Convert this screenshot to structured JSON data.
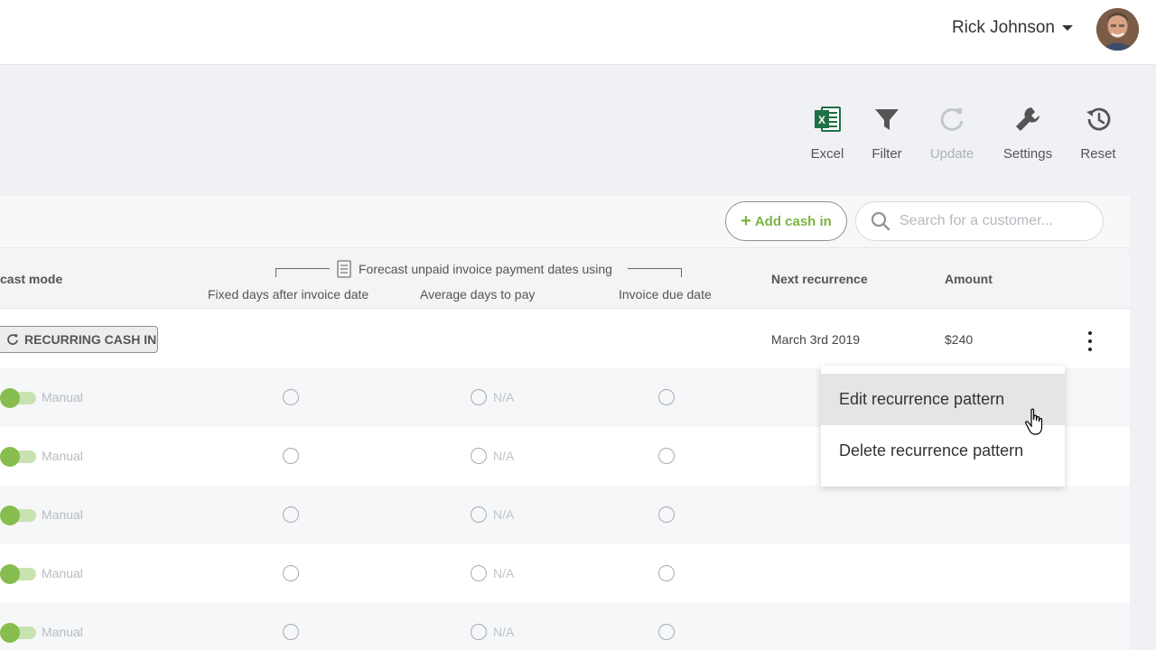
{
  "header": {
    "user_name": "Rick Johnson"
  },
  "toolbar": {
    "items": [
      {
        "label": "Excel",
        "icon": "excel-icon",
        "color": "#1e7145",
        "enabled": true
      },
      {
        "label": "Filter",
        "icon": "filter-icon",
        "enabled": true
      },
      {
        "label": "Update",
        "icon": "refresh-icon",
        "enabled": false
      },
      {
        "label": "Settings",
        "icon": "wrench-icon",
        "enabled": true
      },
      {
        "label": "Reset",
        "icon": "history-icon",
        "enabled": true
      }
    ]
  },
  "actions": {
    "add_cash_label": "Add cash in",
    "search_placeholder": "Search for a customer..."
  },
  "table": {
    "col_forecast_mode": "cast mode",
    "forecast_group_label": "Forecast unpaid invoice payment dates using",
    "col_fixed_days": "Fixed days after invoice date",
    "col_avg_days": "Average days to pay",
    "col_due_date": "Invoice due date",
    "col_next_recurrence": "Next recurrence",
    "col_amount": "Amount",
    "recurring_row": {
      "badge": "RECURRING CASH IN",
      "next_recurrence": "March 3rd 2019",
      "amount": "$240"
    },
    "rows": [
      {
        "mode": "Manual",
        "avg_days": "N/A"
      },
      {
        "mode": "Manual",
        "avg_days": "N/A"
      },
      {
        "mode": "Manual",
        "avg_days": "N/A"
      },
      {
        "mode": "Manual",
        "avg_days": "N/A"
      },
      {
        "mode": "Manual",
        "avg_days": "N/A"
      }
    ]
  },
  "menu": {
    "items": [
      {
        "label": "Edit recurrence pattern",
        "hovered": true
      },
      {
        "label": "Delete recurrence pattern",
        "hovered": false
      }
    ]
  },
  "colors": {
    "accent_green": "#7cb342",
    "toggle_knob": "#86bd4e",
    "excel_green": "#1e7145"
  }
}
